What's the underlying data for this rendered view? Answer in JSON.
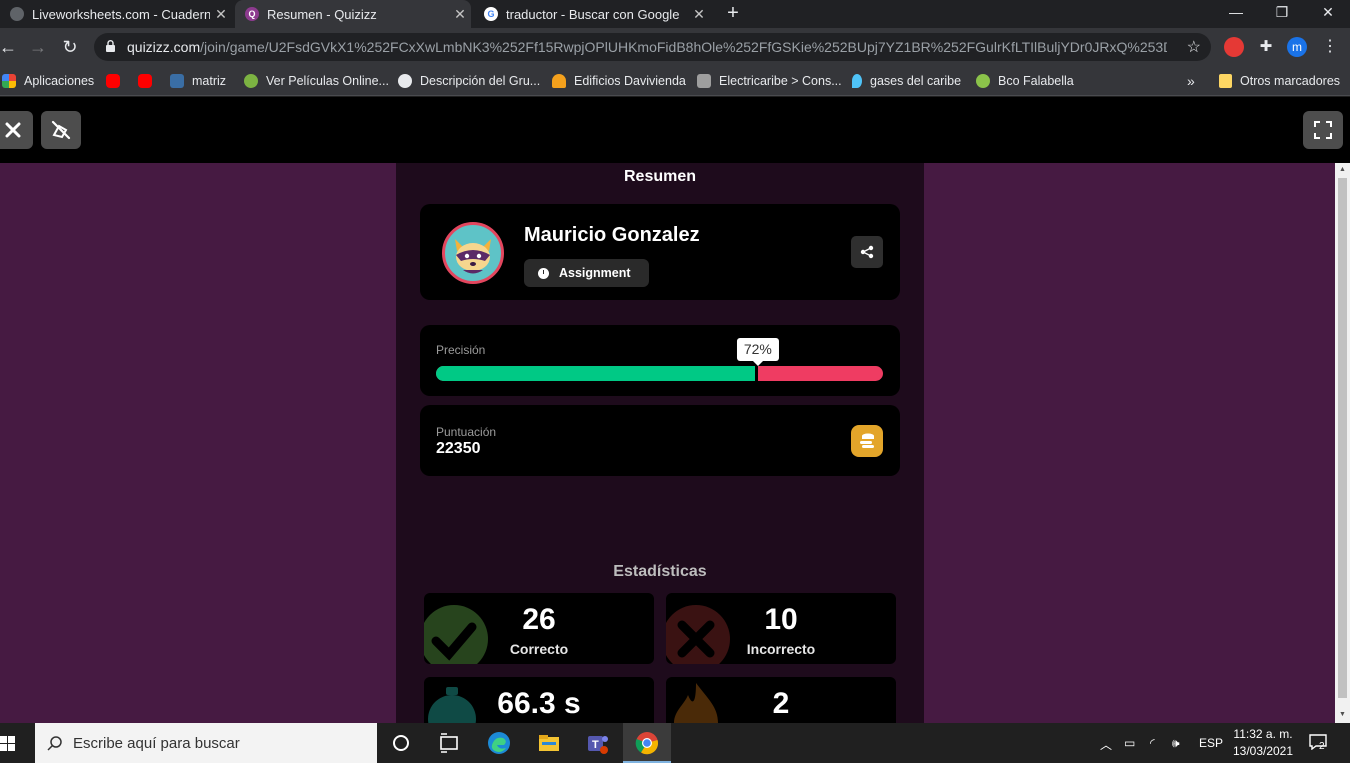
{
  "browser": {
    "tabs": [
      {
        "title": "Liveworksheets.com - Cuadernos",
        "active": false
      },
      {
        "title": "Resumen - Quizizz",
        "active": true
      },
      {
        "title": "traductor - Buscar con Google",
        "active": false
      }
    ],
    "new_tab": "+",
    "window": {
      "minimize": "—",
      "restore": "❐",
      "close": "✕"
    },
    "url_host": "quizizz.com",
    "url_path": "/join/game/U2FsdGVkX1%252FCxXwLmbNK3%252Ff15RwpjOPlUHKmoFidB8hOle%252FfGSKie%252BUpj7YZ1BR%252FGulrKfLTIlBuljYDr0JRxQ%253D%253...",
    "bookmarks": [
      {
        "label": "Aplicaciones",
        "color": "#e94335"
      },
      {
        "label": "",
        "color": "#ff0000"
      },
      {
        "label": "",
        "color": "#ff0000"
      },
      {
        "label": "matriz",
        "color": "#3a6ea5"
      },
      {
        "label": "Ver Películas Online...",
        "color": "#7cb342"
      },
      {
        "label": "Descripción del Gru...",
        "color": "#e8eaed"
      },
      {
        "label": "Edificios Davivienda",
        "color": "#f4a11d"
      },
      {
        "label": "Electricaribe > Cons...",
        "color": "#9e9e9e"
      },
      {
        "label": "gases del caribe",
        "color": "#4fc3f7"
      },
      {
        "label": "Bco Falabella",
        "color": "#8bc34a"
      }
    ],
    "bookmarks_more": "»",
    "other_bookmarks": "Otros marcadores",
    "profile_initial": "m"
  },
  "quiz": {
    "heading": "Resumen",
    "player": {
      "name": "Mauricio Gonzalez",
      "mode": "Assignment"
    },
    "precision": {
      "label": "Precisión",
      "value_text": "72%",
      "value": 0.72
    },
    "score": {
      "label": "Puntuación",
      "value": "22350"
    },
    "stats_heading": "Estadísticas",
    "stats": [
      {
        "value": "26",
        "label": "Correcto"
      },
      {
        "value": "10",
        "label": "Incorrecto"
      },
      {
        "value": "66.3 s",
        "label": ""
      },
      {
        "value": "2",
        "label": ""
      }
    ],
    "colors": {
      "correct": "#00c985",
      "incorrect": "#ef3c62",
      "background": "#461a42",
      "panel": "#1e0b1c",
      "coin": "#e3a52a"
    }
  },
  "taskbar": {
    "search_placeholder": "Escribe aquí para buscar",
    "language": "ESP",
    "time": "11:32 a. m.",
    "date": "13/03/2021",
    "notifications": "2"
  }
}
